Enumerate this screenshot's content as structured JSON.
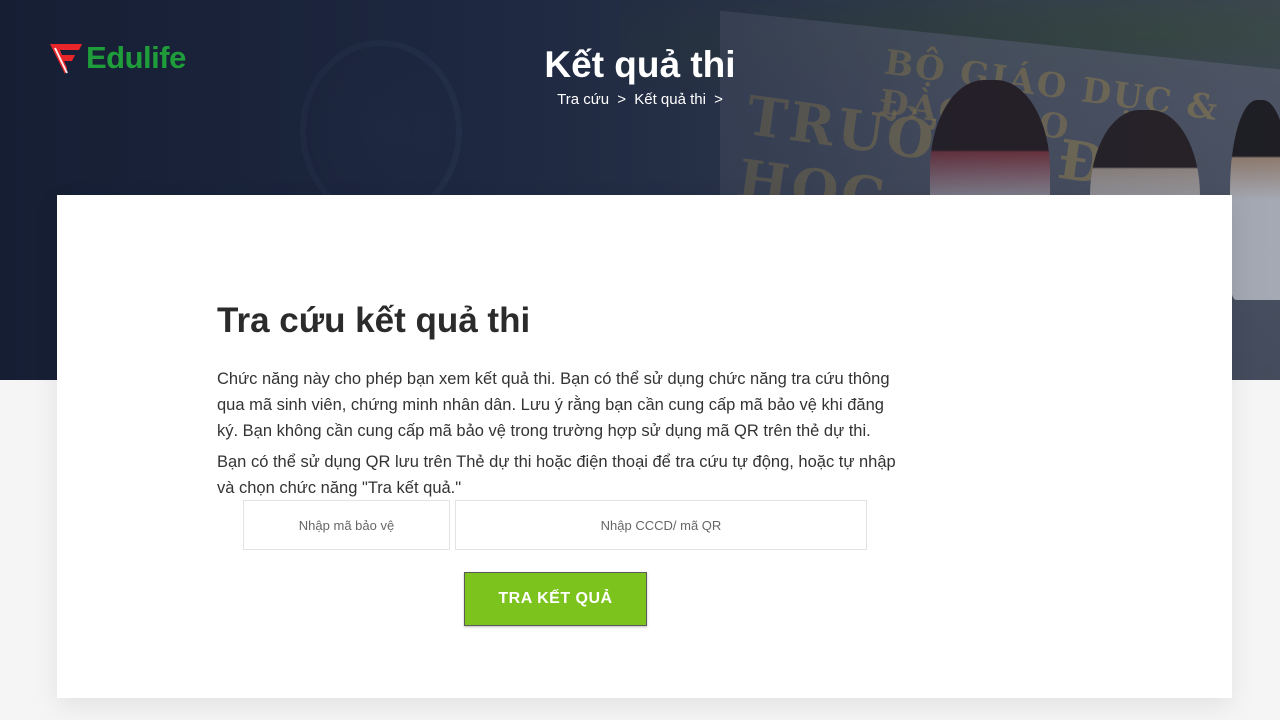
{
  "header": {
    "logo_text": "Edulife",
    "page_title": "Kết quả thi",
    "breadcrumb": {
      "item1": "Tra cứu",
      "separator1": ">",
      "item2": "Kết quả thi",
      "separator2": ">"
    }
  },
  "colors": {
    "brand_red": "#e8262a",
    "brand_green": "#1f9d3a",
    "button_green": "#7cc31e",
    "hero_overlay": "#1c263e"
  },
  "lookup": {
    "title": "Tra cứu kết quả thi",
    "description_1": "Chức năng này cho phép bạn xem kết quả thi. Bạn có thể sử dụng chức năng tra cứu thông qua mã sinh viên, chứng minh nhân dân. Lưu ý rằng bạn cần cung cấp mã bảo vệ khi đăng ký. Bạn không cần cung cấp mã bảo vệ trong trường hợp sử dụng mã QR trên thẻ dự thi.",
    "description_2": "Bạn có thể sử dụng QR lưu trên Thẻ dự thi hoặc điện thoại để tra cứu tự động, hoặc tự nhập và chọn chức năng \"Tra kết quả.\"",
    "security_code_placeholder": "Nhập mã bảo vệ",
    "security_code_value": "",
    "id_placeholder": "Nhập CCCD/ mã QR",
    "id_value": "",
    "submit_label": "TRA KẾT QUẢ"
  },
  "icons": {
    "logo": "edulife-logo-icon"
  }
}
